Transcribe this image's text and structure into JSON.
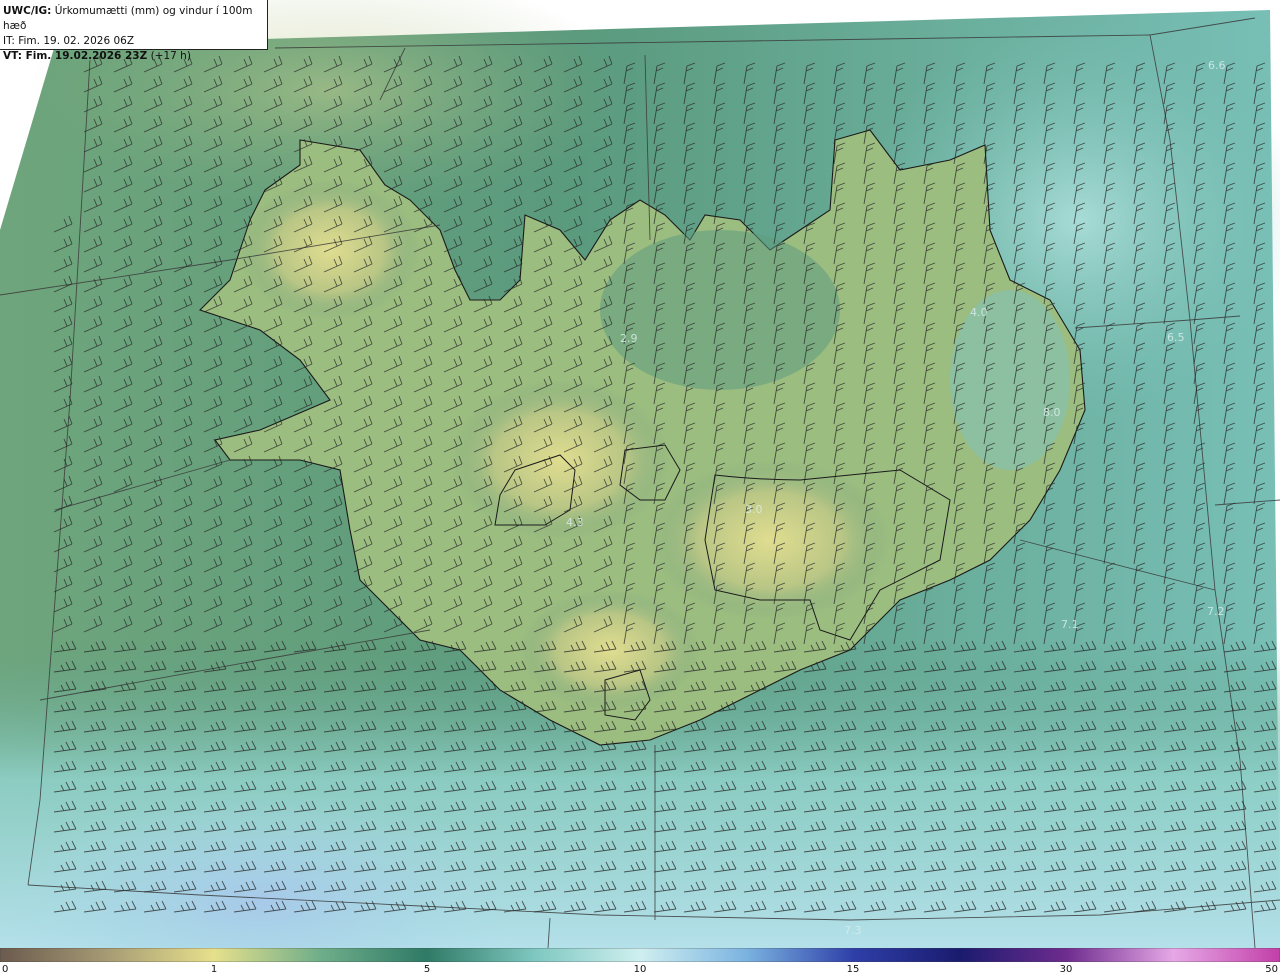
{
  "header": {
    "line1_bold": "UWC/IG:",
    "line1_text": " Úrkomumætti (mm) og vindur í 100m hæð",
    "line2": "IT: Fim. 19. 02. 2026 06Z",
    "line3_bold": "VT: Fim. 19.02.2026 23Z",
    "line3_text": " (+17 h)"
  },
  "map_values": [
    "6.6",
    "4.0",
    "6.5",
    "2.9",
    "8.0",
    "4.3",
    "3.0",
    "7.1",
    "7.2",
    "7.3"
  ],
  "colorbar": {
    "ticks": [
      "0",
      "1",
      "5",
      "10",
      "15",
      "30",
      "50"
    ],
    "colors": [
      "#6b5a4e",
      "#a69a74",
      "#e6e08c",
      "#6fae8a",
      "#2f7a66",
      "#7ec7c0",
      "#cfeff0",
      "#7bb3e0",
      "#2e3fa8",
      "#1a1b6e",
      "#6e2c8e",
      "#e6a8e6",
      "#c23fa8"
    ]
  }
}
